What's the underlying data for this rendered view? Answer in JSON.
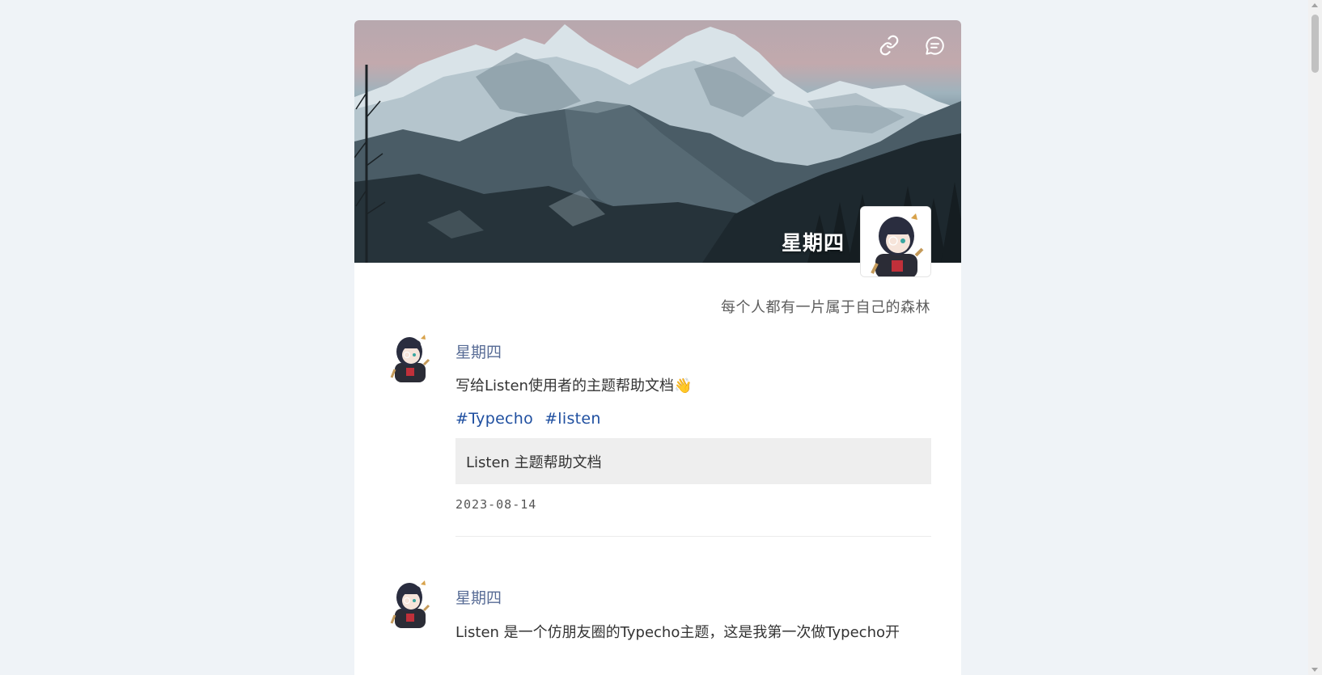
{
  "header": {
    "site_name": "星期四",
    "signature": "每个人都有一片属于自己的森林",
    "actions": [
      {
        "icon": "link-icon"
      },
      {
        "icon": "comment-icon"
      }
    ]
  },
  "posts": [
    {
      "author": "星期四",
      "content": "写给Listen使用者的主题帮助文档👋",
      "tags": [
        "#Typecho",
        "#listen"
      ],
      "link_card": "Listen 主题帮助文档",
      "date": "2023-08-14"
    },
    {
      "author": "星期四",
      "content": "Listen 是一个仿朋友圈的Typecho主题，这是我第一次做Typecho开"
    }
  ],
  "colors": {
    "page_bg": "#eff3f7",
    "author_name": "#576b95",
    "tag": "#1f4fa0",
    "link_card_bg": "#eeeeee"
  }
}
